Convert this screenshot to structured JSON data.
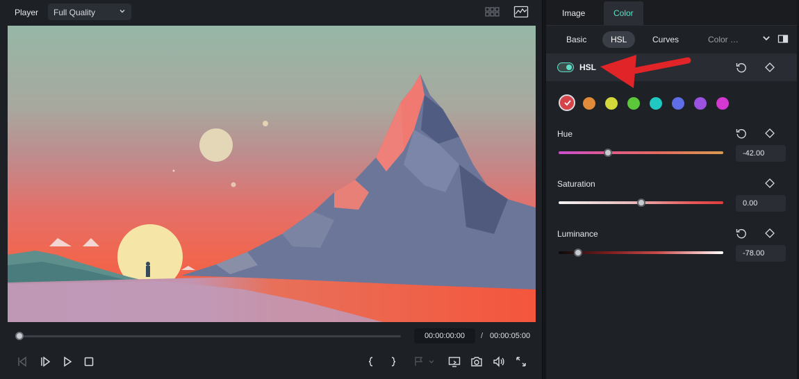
{
  "player": {
    "label": "Player",
    "quality": "Full Quality",
    "current_time": "00:00:00:00",
    "separator": "/",
    "duration": "00:00:05:00",
    "progress": 0.0
  },
  "tabs": [
    {
      "label": "Image",
      "active": false
    },
    {
      "label": "Color",
      "active": true
    }
  ],
  "subtabs": [
    {
      "label": "Basic",
      "active": false
    },
    {
      "label": "HSL",
      "active": true
    },
    {
      "label": "Curves",
      "active": false
    },
    {
      "label": "Color …",
      "active": false
    }
  ],
  "hsl": {
    "title": "HSL",
    "enabled": true,
    "colors": [
      "#d6444a",
      "#e08a3a",
      "#d4d83a",
      "#5bc83a",
      "#1fc8c0",
      "#5e6ee8",
      "#9b52e0",
      "#d438d0"
    ],
    "selected_color": 0
  },
  "params": {
    "hue": {
      "label": "Hue",
      "value": "-42.00",
      "level": 0.3
    },
    "saturation": {
      "label": "Saturation",
      "value": "0.00",
      "level": 0.5
    },
    "luminance": {
      "label": "Luminance",
      "value": "-78.00",
      "level": 0.12
    }
  },
  "colors": {
    "accent": "#5ee0c8",
    "annotation": "#e02428"
  }
}
